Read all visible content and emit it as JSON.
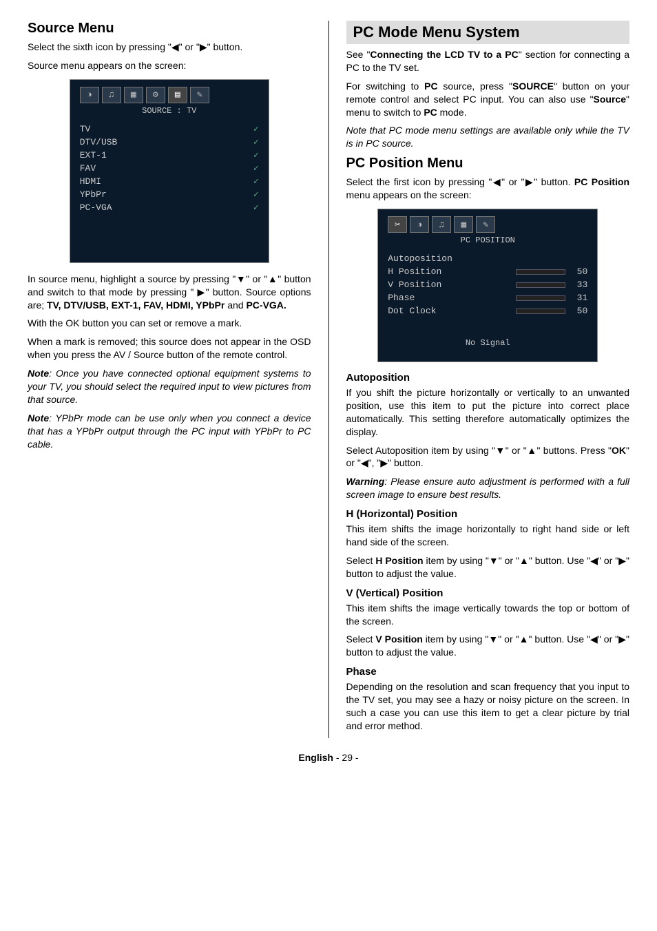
{
  "left": {
    "heading": "Source Menu",
    "p1_a": "Select the sixth icon by pressing \"",
    "p1_b": "\" or \"",
    "p1_c": "\" button.",
    "p2": "Source menu appears on the screen:",
    "osd": {
      "title": "SOURCE : TV",
      "items": [
        "TV",
        "DTV/USB",
        "EXT-1",
        "FAV",
        "HDMI",
        "YPbPr",
        "PC-VGA"
      ]
    },
    "p3_a": "In source menu, highlight a source by pressing \"",
    "p3_b": "\" or \"",
    "p3_c": "\" button and switch to that mode by pressing \" ",
    "p3_d": "\" button. Source options are; ",
    "p3_options": "TV, DTV/USB, EXT-1, FAV, HDMI, YPbPr",
    "p3_and": " and ",
    "p3_last": "PC-VGA.",
    "p4": "With the OK button you can set or remove a mark.",
    "p5": "When a mark is removed; this source does not appear in the OSD when you press the AV / Source button of the remote control.",
    "note1_label": "Note",
    "note1": ": Once you have connected optional equipment systems to your TV, you should select the required input to view pictures from that source.",
    "note2_label": "Note",
    "note2": ": YPbPr mode can be use only when you connect a device that has a YPbPr output through the PC input with YPbPr to PC cable."
  },
  "right": {
    "banner": "PC Mode Menu System",
    "p1_a": "See \"",
    "p1_bold": "Connecting the LCD TV to a PC",
    "p1_b": "\" section for connecting a PC to the TV set.",
    "p2_a": "For switching to ",
    "p2_pc": "PC",
    "p2_b": " source, press \"",
    "p2_src": "SOURCE",
    "p2_c": "\" button on your remote control and select PC input. You can also use \"",
    "p2_menu": "Source",
    "p2_d": "\" menu to switch to ",
    "p2_pc2": "PC",
    "p2_e": " mode.",
    "note_pc": "Note that PC mode menu settings are available only while the TV is in PC source.",
    "pc_pos_heading": "PC Position Menu",
    "pc_pos_p_a": "Select the first icon by pressing \"",
    "pc_pos_p_b": "\" or \"",
    "pc_pos_p_c": "\" button. ",
    "pc_pos_bold": "PC Position",
    "pc_pos_p_d": " menu appears on the screen:",
    "osd": {
      "title": "PC POSITION",
      "rows": [
        {
          "label": "Autoposition",
          "val": ""
        },
        {
          "label": "H Position",
          "val": "50"
        },
        {
          "label": "V Position",
          "val": "33"
        },
        {
          "label": "Phase",
          "val": "31"
        },
        {
          "label": "Dot Clock",
          "val": "50"
        }
      ],
      "footer": "No Signal"
    },
    "auto_h": "Autoposition",
    "auto_p1": "If you shift the picture horizontally or vertically to an unwanted position, use this item to put the picture into correct place automatically. This setting therefore automatically optimizes the display.",
    "auto_p2_a": "Select Autoposition item by using \"",
    "auto_p2_b": "\" or \"",
    "auto_p2_c": "\" buttons. Press \"",
    "auto_p2_ok": "OK",
    "auto_p2_d": "\" or \"",
    "auto_p2_e": "\", \"",
    "auto_p2_f": "\" button.",
    "auto_warn_label": "Warning",
    "auto_warn": ": Please ensure auto adjustment is performed with a full screen image to ensure best results.",
    "hpos_h": "H (Horizontal) Position",
    "hpos_p1": "This item shifts the image horizontally to right hand side or left hand side of the screen.",
    "hpos_p2_a": "Select ",
    "hpos_b": "H Position",
    "hpos_p2_b": " item by using \"",
    "hpos_p2_c": "\" or \"",
    "hpos_p2_d": "\" button. Use \"",
    "hpos_p2_e": "\" or \"",
    "hpos_p2_f": "\" button to adjust the value.",
    "vpos_h": "V (Vertical) Position",
    "vpos_p1": "This item shifts the image vertically towards the top or bottom of the screen.",
    "vpos_p2_a": "Select ",
    "vpos_b": "V Position",
    "vpos_p2_b": " item by using \"",
    "vpos_p2_c": "\" or \"",
    "vpos_p2_d": "\" button. Use \"",
    "vpos_p2_e": "\" or \"",
    "vpos_p2_f": "\" button to adjust the value.",
    "phase_h": "Phase",
    "phase_p": "Depending on the resolution and scan frequency that you input to the TV set, you may see a hazy or noisy picture on the screen. In such a case you can use this item to get a clear picture by trial and error method."
  },
  "footer": {
    "lang": "English",
    "page": "   - 29 -"
  },
  "glyphs": {
    "left": "◀",
    "right": "▶",
    "up": "▲",
    "down": "▼",
    "check": "✓"
  }
}
